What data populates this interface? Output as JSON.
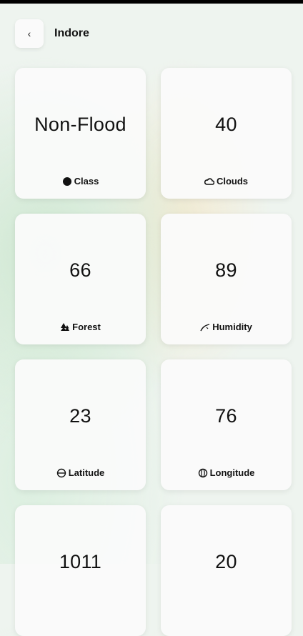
{
  "header": {
    "back_icon": "‹",
    "title": "Indore"
  },
  "cards": [
    {
      "value": "Non-Flood",
      "label": "Class",
      "icon": "circle-icon"
    },
    {
      "value": "40",
      "label": "Clouds",
      "icon": "cloud-icon"
    },
    {
      "value": "66",
      "label": "Forest",
      "icon": "tree-icon"
    },
    {
      "value": "89",
      "label": "Humidity",
      "icon": "humidity-icon"
    },
    {
      "value": "23",
      "label": "Latitude",
      "icon": "latitude-icon"
    },
    {
      "value": "76",
      "label": "Longitude",
      "icon": "longitude-icon"
    },
    {
      "value": "1011",
      "label": "",
      "icon": ""
    },
    {
      "value": "20",
      "label": "",
      "icon": ""
    }
  ]
}
